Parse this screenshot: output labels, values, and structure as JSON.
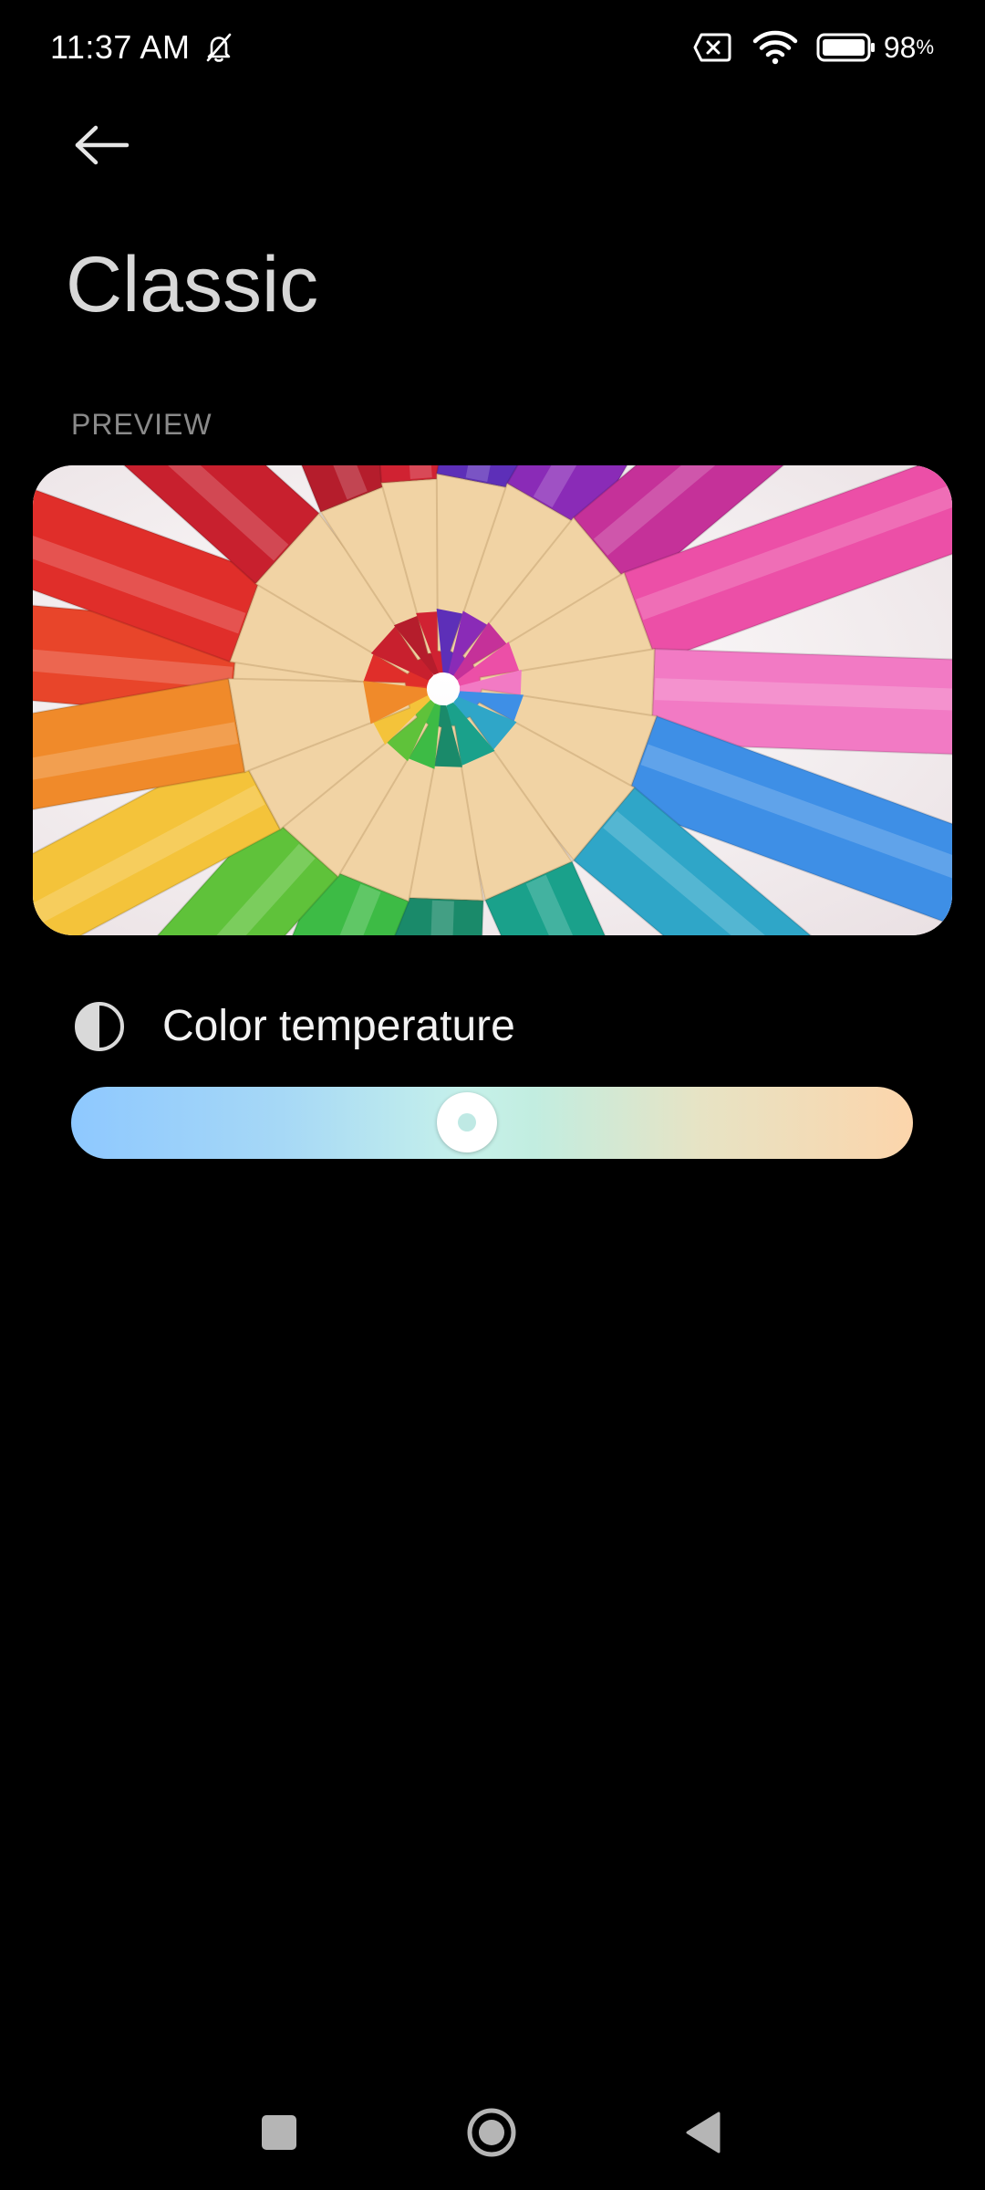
{
  "status_bar": {
    "time": "11:37 AM",
    "battery_percent": "98",
    "battery_percent_sign": "%",
    "icons": [
      "bell-off-icon",
      "sim-error-icon",
      "wifi-icon",
      "battery-icon"
    ]
  },
  "header": {
    "back_icon": "arrow-left-icon",
    "title": "Classic"
  },
  "preview": {
    "label": "PREVIEW",
    "image": "colored-pencils-photo"
  },
  "color_temperature": {
    "icon": "contrast-icon",
    "label": "Color temperature",
    "value_fraction": 0.47,
    "gradient_colors": [
      "#8ec8ff",
      "#c6f1ea",
      "#fcd5ab"
    ]
  },
  "nav_bar": {
    "icons": [
      "recents-square-icon",
      "home-circle-icon",
      "back-triangle-icon"
    ]
  }
}
